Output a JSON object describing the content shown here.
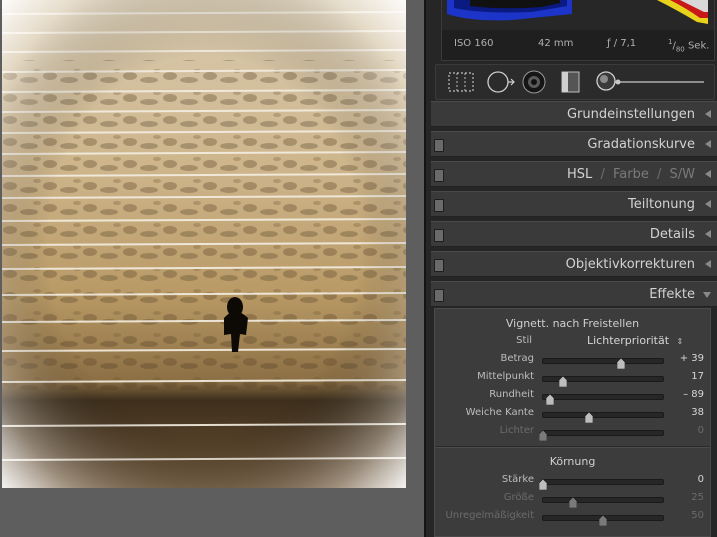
{
  "exif": {
    "iso": "ISO 160",
    "focal": "42 mm",
    "aperture": "ƒ / 7,1",
    "shutter_num": "1",
    "shutter_den": "80",
    "shutter_unit": "Sek."
  },
  "sections": [
    {
      "title": "Grundeinstellungen",
      "toggle": false,
      "expanded": false
    },
    {
      "title": "Gradationskurve",
      "toggle": true,
      "expanded": false
    },
    {
      "title": "Teiltonung",
      "toggle": true,
      "expanded": false
    },
    {
      "title": "Details",
      "toggle": true,
      "expanded": false
    },
    {
      "title": "Objektivkorrekturen",
      "toggle": true,
      "expanded": false
    },
    {
      "title": "Effekte",
      "toggle": true,
      "expanded": true
    }
  ],
  "hsl": {
    "hsl": "HSL",
    "sep1": "/",
    "farbe": "Farbe",
    "sep2": "/",
    "sw": "S/W"
  },
  "vignette": {
    "heading": "Vignett. nach Freistellen",
    "style_label": "Stil",
    "style_value": "Lichterpriorität",
    "sliders": [
      {
        "label": "Betrag",
        "value": "+ 39",
        "position": 0.65,
        "dim": false
      },
      {
        "label": "Mittelpunkt",
        "value": "17",
        "position": 0.17,
        "dim": false
      },
      {
        "label": "Rundheit",
        "value": "– 89",
        "position": 0.06,
        "dim": false
      },
      {
        "label": "Weiche Kante",
        "value": "38",
        "position": 0.38,
        "dim": false
      },
      {
        "label": "Lichter",
        "value": "0",
        "position": 0.0,
        "dim": true
      }
    ]
  },
  "grain": {
    "heading": "Körnung",
    "sliders": [
      {
        "label": "Stärke",
        "value": "0",
        "position": 0.0,
        "dim": false
      },
      {
        "label": "Größe",
        "value": "25",
        "position": 0.25,
        "dim": true
      },
      {
        "label": "Unregelmäßigkeit",
        "value": "50",
        "position": 0.5,
        "dim": true
      }
    ]
  },
  "colors": {
    "panel": "#262626",
    "section_header": "#3a3a3a",
    "photo_tone": "#c9b48a"
  }
}
